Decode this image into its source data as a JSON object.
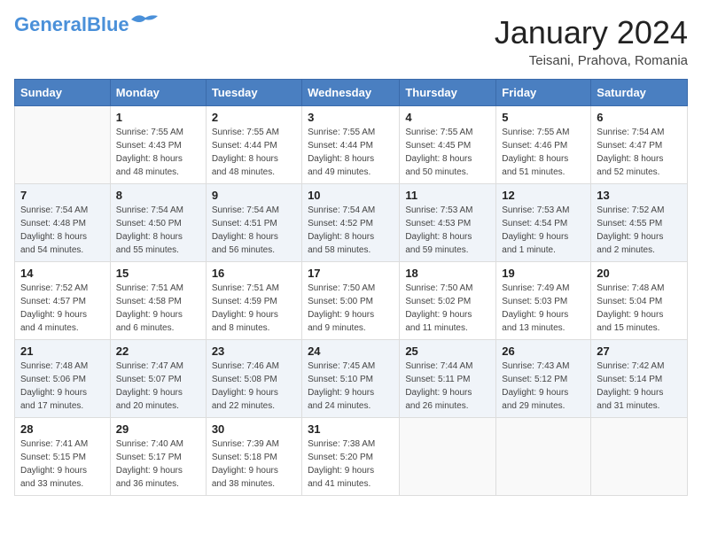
{
  "header": {
    "logo_line1": "General",
    "logo_line2": "Blue",
    "month": "January 2024",
    "location": "Teisani, Prahova, Romania"
  },
  "days_of_week": [
    "Sunday",
    "Monday",
    "Tuesday",
    "Wednesday",
    "Thursday",
    "Friday",
    "Saturday"
  ],
  "weeks": [
    [
      {
        "num": "",
        "info": ""
      },
      {
        "num": "1",
        "info": "Sunrise: 7:55 AM\nSunset: 4:43 PM\nDaylight: 8 hours\nand 48 minutes."
      },
      {
        "num": "2",
        "info": "Sunrise: 7:55 AM\nSunset: 4:44 PM\nDaylight: 8 hours\nand 48 minutes."
      },
      {
        "num": "3",
        "info": "Sunrise: 7:55 AM\nSunset: 4:44 PM\nDaylight: 8 hours\nand 49 minutes."
      },
      {
        "num": "4",
        "info": "Sunrise: 7:55 AM\nSunset: 4:45 PM\nDaylight: 8 hours\nand 50 minutes."
      },
      {
        "num": "5",
        "info": "Sunrise: 7:55 AM\nSunset: 4:46 PM\nDaylight: 8 hours\nand 51 minutes."
      },
      {
        "num": "6",
        "info": "Sunrise: 7:54 AM\nSunset: 4:47 PM\nDaylight: 8 hours\nand 52 minutes."
      }
    ],
    [
      {
        "num": "7",
        "info": "Sunrise: 7:54 AM\nSunset: 4:48 PM\nDaylight: 8 hours\nand 54 minutes."
      },
      {
        "num": "8",
        "info": "Sunrise: 7:54 AM\nSunset: 4:50 PM\nDaylight: 8 hours\nand 55 minutes."
      },
      {
        "num": "9",
        "info": "Sunrise: 7:54 AM\nSunset: 4:51 PM\nDaylight: 8 hours\nand 56 minutes."
      },
      {
        "num": "10",
        "info": "Sunrise: 7:54 AM\nSunset: 4:52 PM\nDaylight: 8 hours\nand 58 minutes."
      },
      {
        "num": "11",
        "info": "Sunrise: 7:53 AM\nSunset: 4:53 PM\nDaylight: 8 hours\nand 59 minutes."
      },
      {
        "num": "12",
        "info": "Sunrise: 7:53 AM\nSunset: 4:54 PM\nDaylight: 9 hours\nand 1 minute."
      },
      {
        "num": "13",
        "info": "Sunrise: 7:52 AM\nSunset: 4:55 PM\nDaylight: 9 hours\nand 2 minutes."
      }
    ],
    [
      {
        "num": "14",
        "info": "Sunrise: 7:52 AM\nSunset: 4:57 PM\nDaylight: 9 hours\nand 4 minutes."
      },
      {
        "num": "15",
        "info": "Sunrise: 7:51 AM\nSunset: 4:58 PM\nDaylight: 9 hours\nand 6 minutes."
      },
      {
        "num": "16",
        "info": "Sunrise: 7:51 AM\nSunset: 4:59 PM\nDaylight: 9 hours\nand 8 minutes."
      },
      {
        "num": "17",
        "info": "Sunrise: 7:50 AM\nSunset: 5:00 PM\nDaylight: 9 hours\nand 9 minutes."
      },
      {
        "num": "18",
        "info": "Sunrise: 7:50 AM\nSunset: 5:02 PM\nDaylight: 9 hours\nand 11 minutes."
      },
      {
        "num": "19",
        "info": "Sunrise: 7:49 AM\nSunset: 5:03 PM\nDaylight: 9 hours\nand 13 minutes."
      },
      {
        "num": "20",
        "info": "Sunrise: 7:48 AM\nSunset: 5:04 PM\nDaylight: 9 hours\nand 15 minutes."
      }
    ],
    [
      {
        "num": "21",
        "info": "Sunrise: 7:48 AM\nSunset: 5:06 PM\nDaylight: 9 hours\nand 17 minutes."
      },
      {
        "num": "22",
        "info": "Sunrise: 7:47 AM\nSunset: 5:07 PM\nDaylight: 9 hours\nand 20 minutes."
      },
      {
        "num": "23",
        "info": "Sunrise: 7:46 AM\nSunset: 5:08 PM\nDaylight: 9 hours\nand 22 minutes."
      },
      {
        "num": "24",
        "info": "Sunrise: 7:45 AM\nSunset: 5:10 PM\nDaylight: 9 hours\nand 24 minutes."
      },
      {
        "num": "25",
        "info": "Sunrise: 7:44 AM\nSunset: 5:11 PM\nDaylight: 9 hours\nand 26 minutes."
      },
      {
        "num": "26",
        "info": "Sunrise: 7:43 AM\nSunset: 5:12 PM\nDaylight: 9 hours\nand 29 minutes."
      },
      {
        "num": "27",
        "info": "Sunrise: 7:42 AM\nSunset: 5:14 PM\nDaylight: 9 hours\nand 31 minutes."
      }
    ],
    [
      {
        "num": "28",
        "info": "Sunrise: 7:41 AM\nSunset: 5:15 PM\nDaylight: 9 hours\nand 33 minutes."
      },
      {
        "num": "29",
        "info": "Sunrise: 7:40 AM\nSunset: 5:17 PM\nDaylight: 9 hours\nand 36 minutes."
      },
      {
        "num": "30",
        "info": "Sunrise: 7:39 AM\nSunset: 5:18 PM\nDaylight: 9 hours\nand 38 minutes."
      },
      {
        "num": "31",
        "info": "Sunrise: 7:38 AM\nSunset: 5:20 PM\nDaylight: 9 hours\nand 41 minutes."
      },
      {
        "num": "",
        "info": ""
      },
      {
        "num": "",
        "info": ""
      },
      {
        "num": "",
        "info": ""
      }
    ]
  ]
}
